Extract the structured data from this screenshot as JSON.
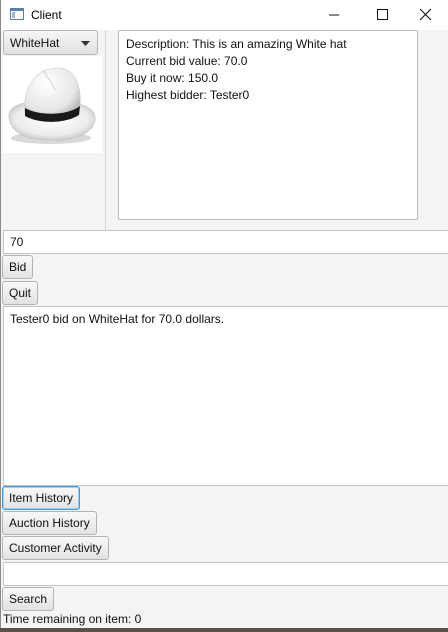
{
  "window": {
    "title": "Client",
    "icon": "app-window-icon",
    "controls": [
      "minimize-icon",
      "maximize-icon",
      "close-icon"
    ]
  },
  "item_select": {
    "selected": "WhiteHat",
    "image": "white-fedora-hat-image"
  },
  "details": {
    "description": "Description: This is an amazing White hat",
    "current_bid": "Current bid value: 70.0",
    "buy_now": "Buy it now: 150.0",
    "highest_bidder": "Highest bidder: Tester0"
  },
  "bid_input": {
    "value": "70"
  },
  "buttons": {
    "bid": "Bid",
    "quit": "Quit",
    "item_history": "Item History",
    "auction_history": "Auction History",
    "customer_activity": "Customer Activity",
    "search": "Search"
  },
  "log": {
    "message": "Tester0 bid on WhiteHat for 70.0 dollars."
  },
  "search_input": {
    "value": ""
  },
  "status": {
    "time_remaining": "Time remaining on item: 0"
  }
}
